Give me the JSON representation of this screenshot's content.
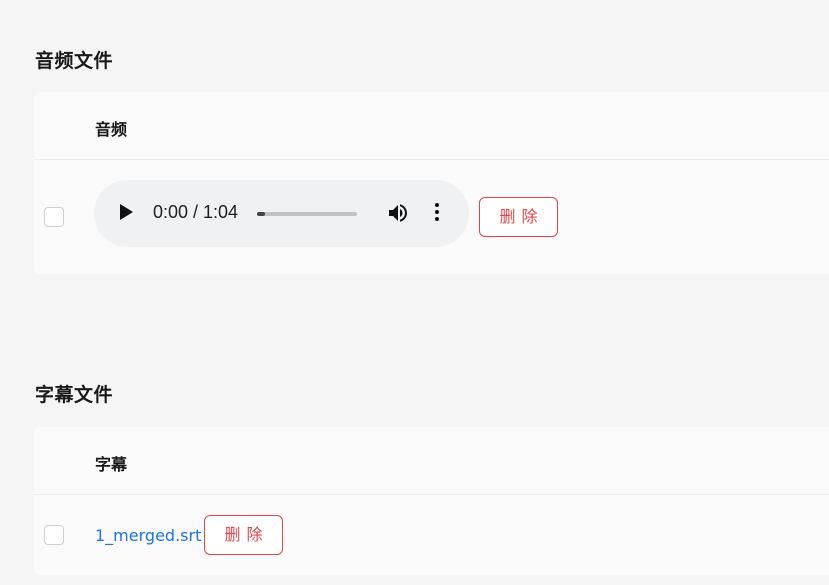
{
  "audio_section": {
    "title": "音频文件",
    "column_header": "音频",
    "player": {
      "time_display": "0:00 / 1:04",
      "progress_fraction": 0.08
    },
    "delete_label": "删除"
  },
  "subtitle_section": {
    "title": "字幕文件",
    "column_header": "字幕",
    "file_name": "1_merged.srt",
    "delete_label": "删除"
  },
  "colors": {
    "danger": "#e0454a",
    "link": "#1a73e8",
    "background": "#f5f5f5"
  }
}
